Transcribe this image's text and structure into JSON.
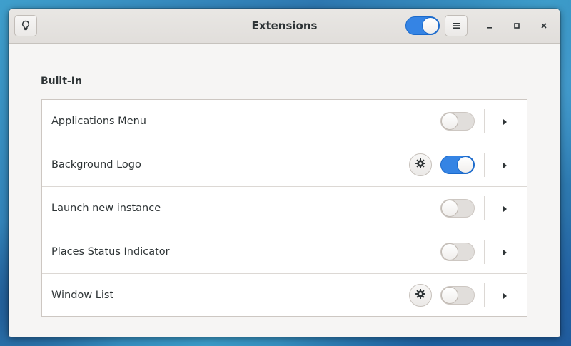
{
  "window": {
    "title": "Extensions",
    "global_switch_on": true
  },
  "section": {
    "title": "Built-In"
  },
  "extensions": [
    {
      "name": "Applications Menu",
      "enabled": false,
      "has_settings": false
    },
    {
      "name": "Background Logo",
      "enabled": true,
      "has_settings": true
    },
    {
      "name": "Launch new instance",
      "enabled": false,
      "has_settings": false
    },
    {
      "name": "Places Status Indicator",
      "enabled": false,
      "has_settings": false
    },
    {
      "name": "Window List",
      "enabled": false,
      "has_settings": true
    }
  ],
  "icons": {
    "help": "lightbulb-icon",
    "menu": "hamburger-menu-icon",
    "minimize": "minimize-icon",
    "maximize": "maximize-icon",
    "close": "close-icon",
    "settings": "gear-icon",
    "details": "chevron-right-icon"
  },
  "colors": {
    "accent": "#3584e4",
    "window_bg": "#f6f5f4",
    "text": "#2e3436"
  }
}
